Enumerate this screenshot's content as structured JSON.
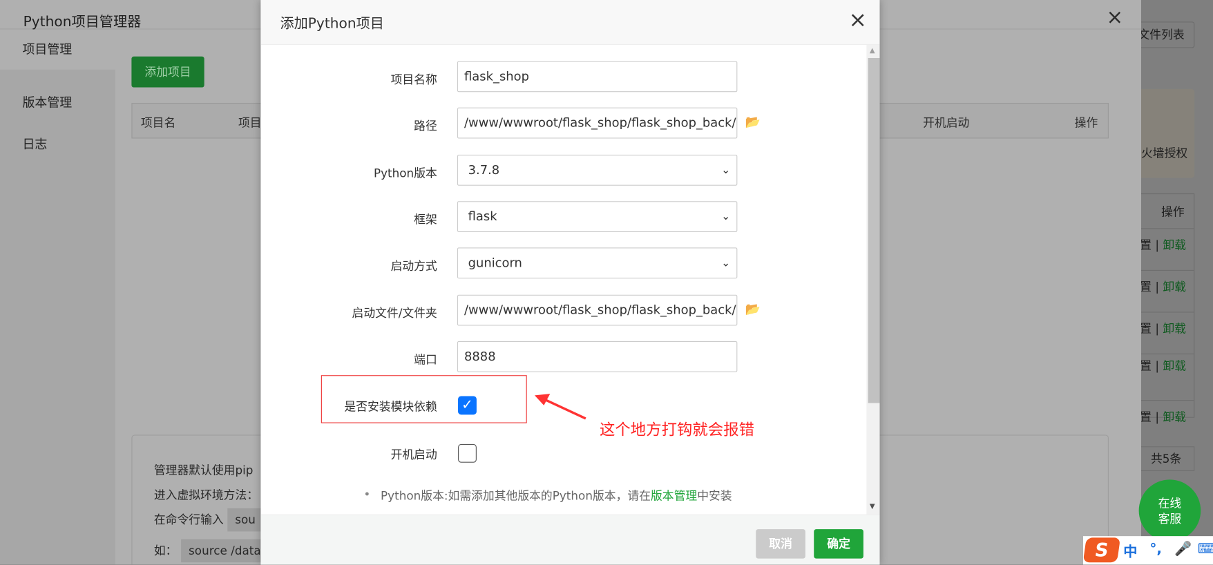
{
  "background_page": {
    "title": "Python项目管理器",
    "close_icon": "×",
    "sidebar": [
      {
        "label": "项目管理",
        "active": true
      },
      {
        "label": "版本管理"
      },
      {
        "label": "日志"
      }
    ],
    "add_button": "添加项目",
    "table_headers": [
      "项目名",
      "项目",
      "开机启动",
      "操作"
    ],
    "info_lines": [
      "管理器默认使用pip",
      "进入虚拟环境方法：",
      "在命令行输入",
      "sou",
      "如：",
      "source /data"
    ],
    "right": {
      "file_list_button": "文件列表",
      "firewall_text": "防火墙授权",
      "ops_header": "操作",
      "row_actions": [
        "置",
        "|",
        "卸载"
      ],
      "row_count": 5,
      "total": "共5条"
    }
  },
  "modal": {
    "title": "添加Python项目",
    "close_icon": "×",
    "fields": {
      "name": {
        "label": "项目名称",
        "value": "flask_shop"
      },
      "path": {
        "label": "路径",
        "value": "/www/wwwroot/flask_shop/flask_shop_back/"
      },
      "python_version": {
        "label": "Python版本",
        "value": "3.7.8"
      },
      "framework": {
        "label": "框架",
        "value": "flask"
      },
      "start_mode": {
        "label": "启动方式",
        "value": "gunicorn"
      },
      "start_file": {
        "label": "启动文件/文件夹",
        "value": "/www/wwwroot/flask_shop/flask_shop_back/r"
      },
      "port": {
        "label": "端口",
        "value": "8888"
      },
      "install_deps": {
        "label": "是否安装模块依赖",
        "checked": true
      },
      "autostart": {
        "label": "开机启动",
        "checked": false
      }
    },
    "tip": {
      "prefix": "Python版本:如需添加其他版本的Python版本，请在",
      "link": "版本管理",
      "suffix": "中安装"
    },
    "cancel": "取消",
    "ok": "确定"
  },
  "annotation": "这个地方打钩就会报错",
  "service_button": [
    "在线",
    "客服"
  ],
  "ime": {
    "logo": "S",
    "mode": "中",
    "punct": "°,"
  },
  "colors": {
    "accent": "#20a53a",
    "annotation": "#ff2222",
    "checkbox": "#0a74ff"
  }
}
